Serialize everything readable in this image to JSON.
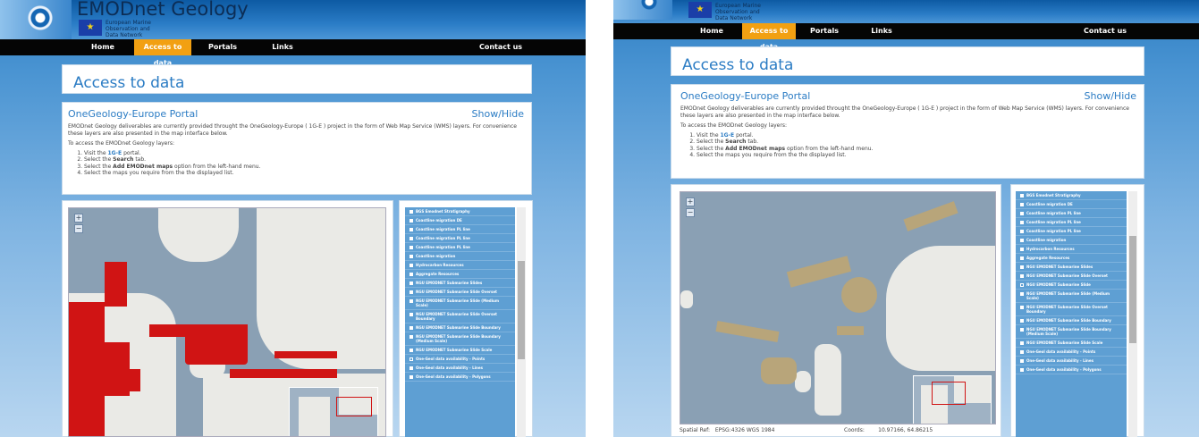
{
  "brand": {
    "title": "EMODnet Geology",
    "network_text": "European Marine Observation and Data Network",
    "eu_flag_glyph": "★"
  },
  "nav": {
    "items": [
      {
        "label": "Home"
      },
      {
        "label": "Access to data"
      },
      {
        "label": "Portals"
      },
      {
        "label": "Links"
      },
      {
        "label": "Contact us"
      }
    ],
    "active_index": 1,
    "active_color": "#f2a012"
  },
  "page_title": "Access to data",
  "portal": {
    "title": "OneGeology-Europe Portal",
    "show_hide": "Show/Hide",
    "description_left": "EMODnet Geology deliverables are currently provided throught the OneGeology-Europe ( 1G-E ) project in the form of Web Map Service (WMS) layers. For convenience these layers are also presented in the map interface below.",
    "description_right": "EMODnet Geology deliverables are currently provided throught the OneGeology-Europe ( 1G-E ) project in the form of Web Map Service (WMS) layers. For convenience these layers are also presented in the map interface below.",
    "access_intro": "To access the EMODnet Geology layers:",
    "steps_left": [
      {
        "pre": "Visit the ",
        "link": "1G-E",
        "post": " portal."
      },
      {
        "pre": "Select the ",
        "link": "Search",
        "post": " tab."
      },
      {
        "pre": "Select the ",
        "link": "Add EMODnet maps",
        "post": " option from the left-hand menu."
      },
      {
        "pre": "Select the maps you require from the the displayed list.",
        "link": "",
        "post": ""
      }
    ],
    "steps_right": [
      {
        "pre": "Visit the ",
        "link": "1G-E",
        "post": " portal."
      },
      {
        "pre": "Select the ",
        "link": "Search",
        "post": " tab."
      },
      {
        "pre": "Select the ",
        "link": "Add EMODnet maps",
        "post": " option from the left-hand menu."
      },
      {
        "pre": "Select the maps you require from the the displayed list.",
        "link": "",
        "post": ""
      }
    ]
  },
  "map": {
    "zoom_in": "+",
    "zoom_out": "−",
    "spatial_ref_label": "Spatial Ref:",
    "spatial_ref_value": "EPSG:4326 WGS 1984",
    "coords_label": "Coords:",
    "coords_value": "10.97166, 64.86215",
    "colors": {
      "sea": "#8aa0b4",
      "land": "#eaeae6",
      "red_layer": "#d01414",
      "tan_layer": "#b8a57a"
    }
  },
  "layers": {
    "left": [
      {
        "label": "BGS Emodnet Stratigraphy",
        "checked": true
      },
      {
        "label": "Coastline migration DE",
        "checked": true
      },
      {
        "label": "Coastline migration PL line",
        "checked": true
      },
      {
        "label": "Coastline migration PL line",
        "checked": true
      },
      {
        "label": "Coastline migration PL line",
        "checked": true
      },
      {
        "label": "Coastline migration",
        "checked": true
      },
      {
        "label": "Hydrocarbon Resources",
        "checked": true
      },
      {
        "label": "Aggregate Resources",
        "checked": true
      },
      {
        "label": "NGU EMODNET Submarine Slides",
        "checked": true
      },
      {
        "label": "NGU EMODNET Submarine Slide Overset",
        "checked": true
      },
      {
        "label": "NGU EMODNET Submarine Slide (Medium Scale)",
        "checked": true
      },
      {
        "label": "NGU EMODNET Submarine Slide Overset Boundary",
        "checked": true
      },
      {
        "label": "NGU EMODNET Submarine Slide Boundary",
        "checked": true
      },
      {
        "label": "NGU EMODNET Submarine Slide Boundary (Medium Scale)",
        "checked": true
      },
      {
        "label": "NGU EMODNET Submarine Slide Scale",
        "checked": true
      },
      {
        "label": "One-Geol data availability - Points",
        "checked": false
      },
      {
        "label": "One-Geol data availability - Lines",
        "checked": true
      },
      {
        "label": "One-Geol data availability - Polygons",
        "checked": true
      }
    ],
    "right": [
      {
        "label": "BGS Emodnet Stratigraphy",
        "checked": true
      },
      {
        "label": "Coastline migration DE",
        "checked": true
      },
      {
        "label": "Coastline migration PL line",
        "checked": true
      },
      {
        "label": "Coastline migration PL line",
        "checked": true
      },
      {
        "label": "Coastline migration PL line",
        "checked": true
      },
      {
        "label": "Coastline migration",
        "checked": true
      },
      {
        "label": "Hydrocarbon Resources",
        "checked": true
      },
      {
        "label": "Aggregate Resources",
        "checked": true
      },
      {
        "label": "NGU EMODNET Submarine Slides",
        "checked": true
      },
      {
        "label": "NGU EMODNET Submarine Slide Overset",
        "checked": true
      },
      {
        "label": "NGU EMODNET Submarine Slide",
        "checked": false
      },
      {
        "label": "NGU EMODNET Submarine Slide (Medium Scale)",
        "checked": true
      },
      {
        "label": "NGU EMODNET Submarine Slide Overset Boundary",
        "checked": true
      },
      {
        "label": "NGU EMODNET Submarine Slide Boundary",
        "checked": true
      },
      {
        "label": "NGU EMODNET Submarine Slide Boundary (Medium Scale)",
        "checked": true
      },
      {
        "label": "NGU EMODNET Submarine Slide Scale",
        "checked": true
      },
      {
        "label": "One-Geol data availability - Points",
        "checked": true
      },
      {
        "label": "One-Geol data availability - Lines",
        "checked": true
      },
      {
        "label": "One-Geol data availability - Polygons",
        "checked": true
      }
    ]
  }
}
